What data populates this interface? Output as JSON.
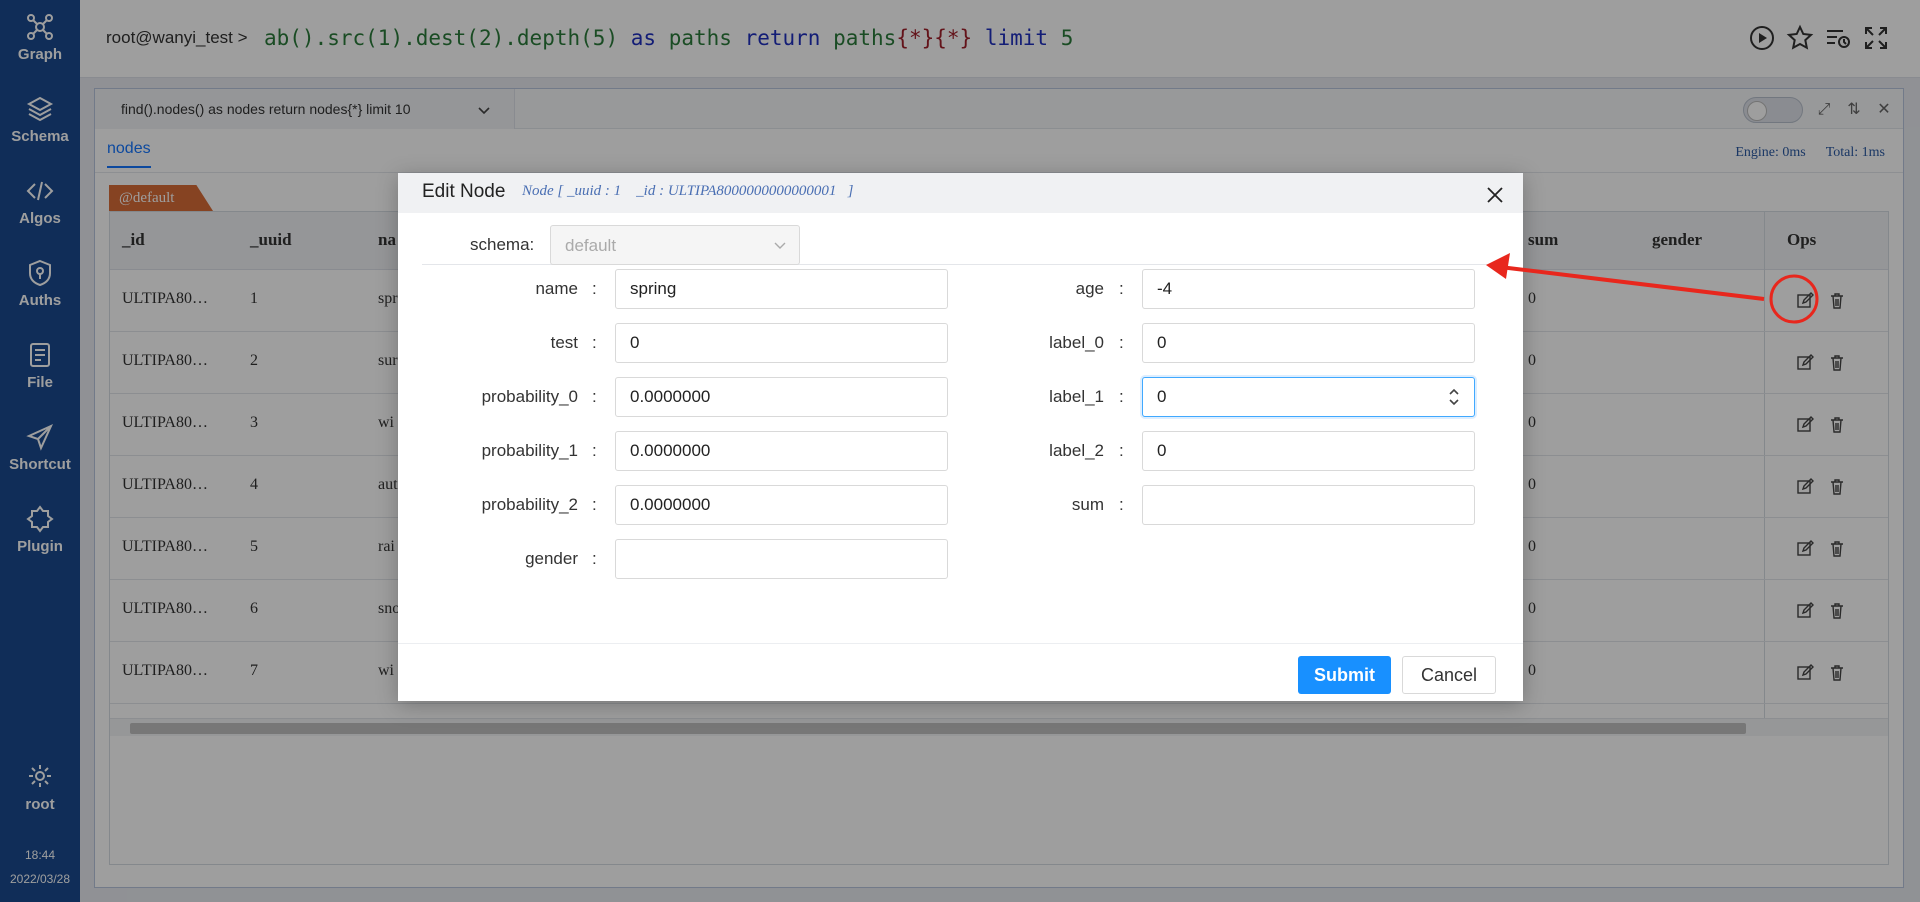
{
  "sidebar": {
    "items": [
      {
        "label": "Graph",
        "icon": "graph-icon"
      },
      {
        "label": "Schema",
        "icon": "layers-icon"
      },
      {
        "label": "Algos",
        "icon": "code-icon"
      },
      {
        "label": "Auths",
        "icon": "shield-icon"
      },
      {
        "label": "File",
        "icon": "file-icon"
      },
      {
        "label": "Shortcut",
        "icon": "send-icon"
      },
      {
        "label": "Plugin",
        "icon": "puzzle-icon"
      }
    ],
    "user": "root",
    "time": "18:44",
    "date": "2022/03/28"
  },
  "query": {
    "user": "root@wanyi_test >",
    "parts": {
      "fn": "ab().src(",
      "n1": "1",
      "p2": ").dest(",
      "n2": "2",
      "p3": ").depth(",
      "n3": "5",
      "p4": ")",
      "as": "as",
      "paths1": "paths",
      "ret": "return",
      "paths2": "paths",
      "b1": "{*}{*}",
      "limit": "limit",
      "n4": "5"
    }
  },
  "panel": {
    "tab_label": "find().nodes() as nodes return nodes{*} limit 10",
    "subtab": "nodes",
    "engine": "Engine: 0ms",
    "total": "Total: 1ms",
    "schema_tag": "@default",
    "columns": [
      "_id",
      "_uuid",
      "na",
      "sum",
      "gender",
      "Ops"
    ],
    "rows": [
      {
        "id": "ULTIPA80…",
        "uuid": "1",
        "name": "spr",
        "sum": "0"
      },
      {
        "id": "ULTIPA80…",
        "uuid": "2",
        "name": "sur",
        "sum": "0"
      },
      {
        "id": "ULTIPA80…",
        "uuid": "3",
        "name": "wi",
        "sum": "0"
      },
      {
        "id": "ULTIPA80…",
        "uuid": "4",
        "name": "aut",
        "sum": "0"
      },
      {
        "id": "ULTIPA80…",
        "uuid": "5",
        "name": "rai",
        "sum": "0"
      },
      {
        "id": "ULTIPA80…",
        "uuid": "6",
        "name": "sno",
        "sum": "0"
      },
      {
        "id": "ULTIPA80…",
        "uuid": "7",
        "name": "wi",
        "sum": "0"
      }
    ]
  },
  "modal": {
    "title": "Edit Node",
    "subtitle": "Node [ _uuid : 1    _id : ULTIPA8000000000000001   ]",
    "schema_label": "schema:",
    "schema_value": "default",
    "left_fields": [
      {
        "label": "name",
        "value": "spring"
      },
      {
        "label": "test",
        "value": "0"
      },
      {
        "label": "probability_0",
        "value": "0.0000000"
      },
      {
        "label": "probability_1",
        "value": "0.0000000"
      },
      {
        "label": "probability_2",
        "value": "0.0000000"
      },
      {
        "label": "gender",
        "value": ""
      }
    ],
    "right_fields": [
      {
        "label": "age",
        "value": "-4"
      },
      {
        "label": "label_0",
        "value": "0"
      },
      {
        "label": "label_1",
        "value": "0"
      },
      {
        "label": "label_2",
        "value": "0"
      },
      {
        "label": "sum",
        "value": ""
      }
    ],
    "colon": ":",
    "submit": "Submit",
    "cancel": "Cancel"
  },
  "colors": {
    "sidebar": "#1a4a8f",
    "accent": "#1890ff",
    "annotation": "#e8271d"
  }
}
